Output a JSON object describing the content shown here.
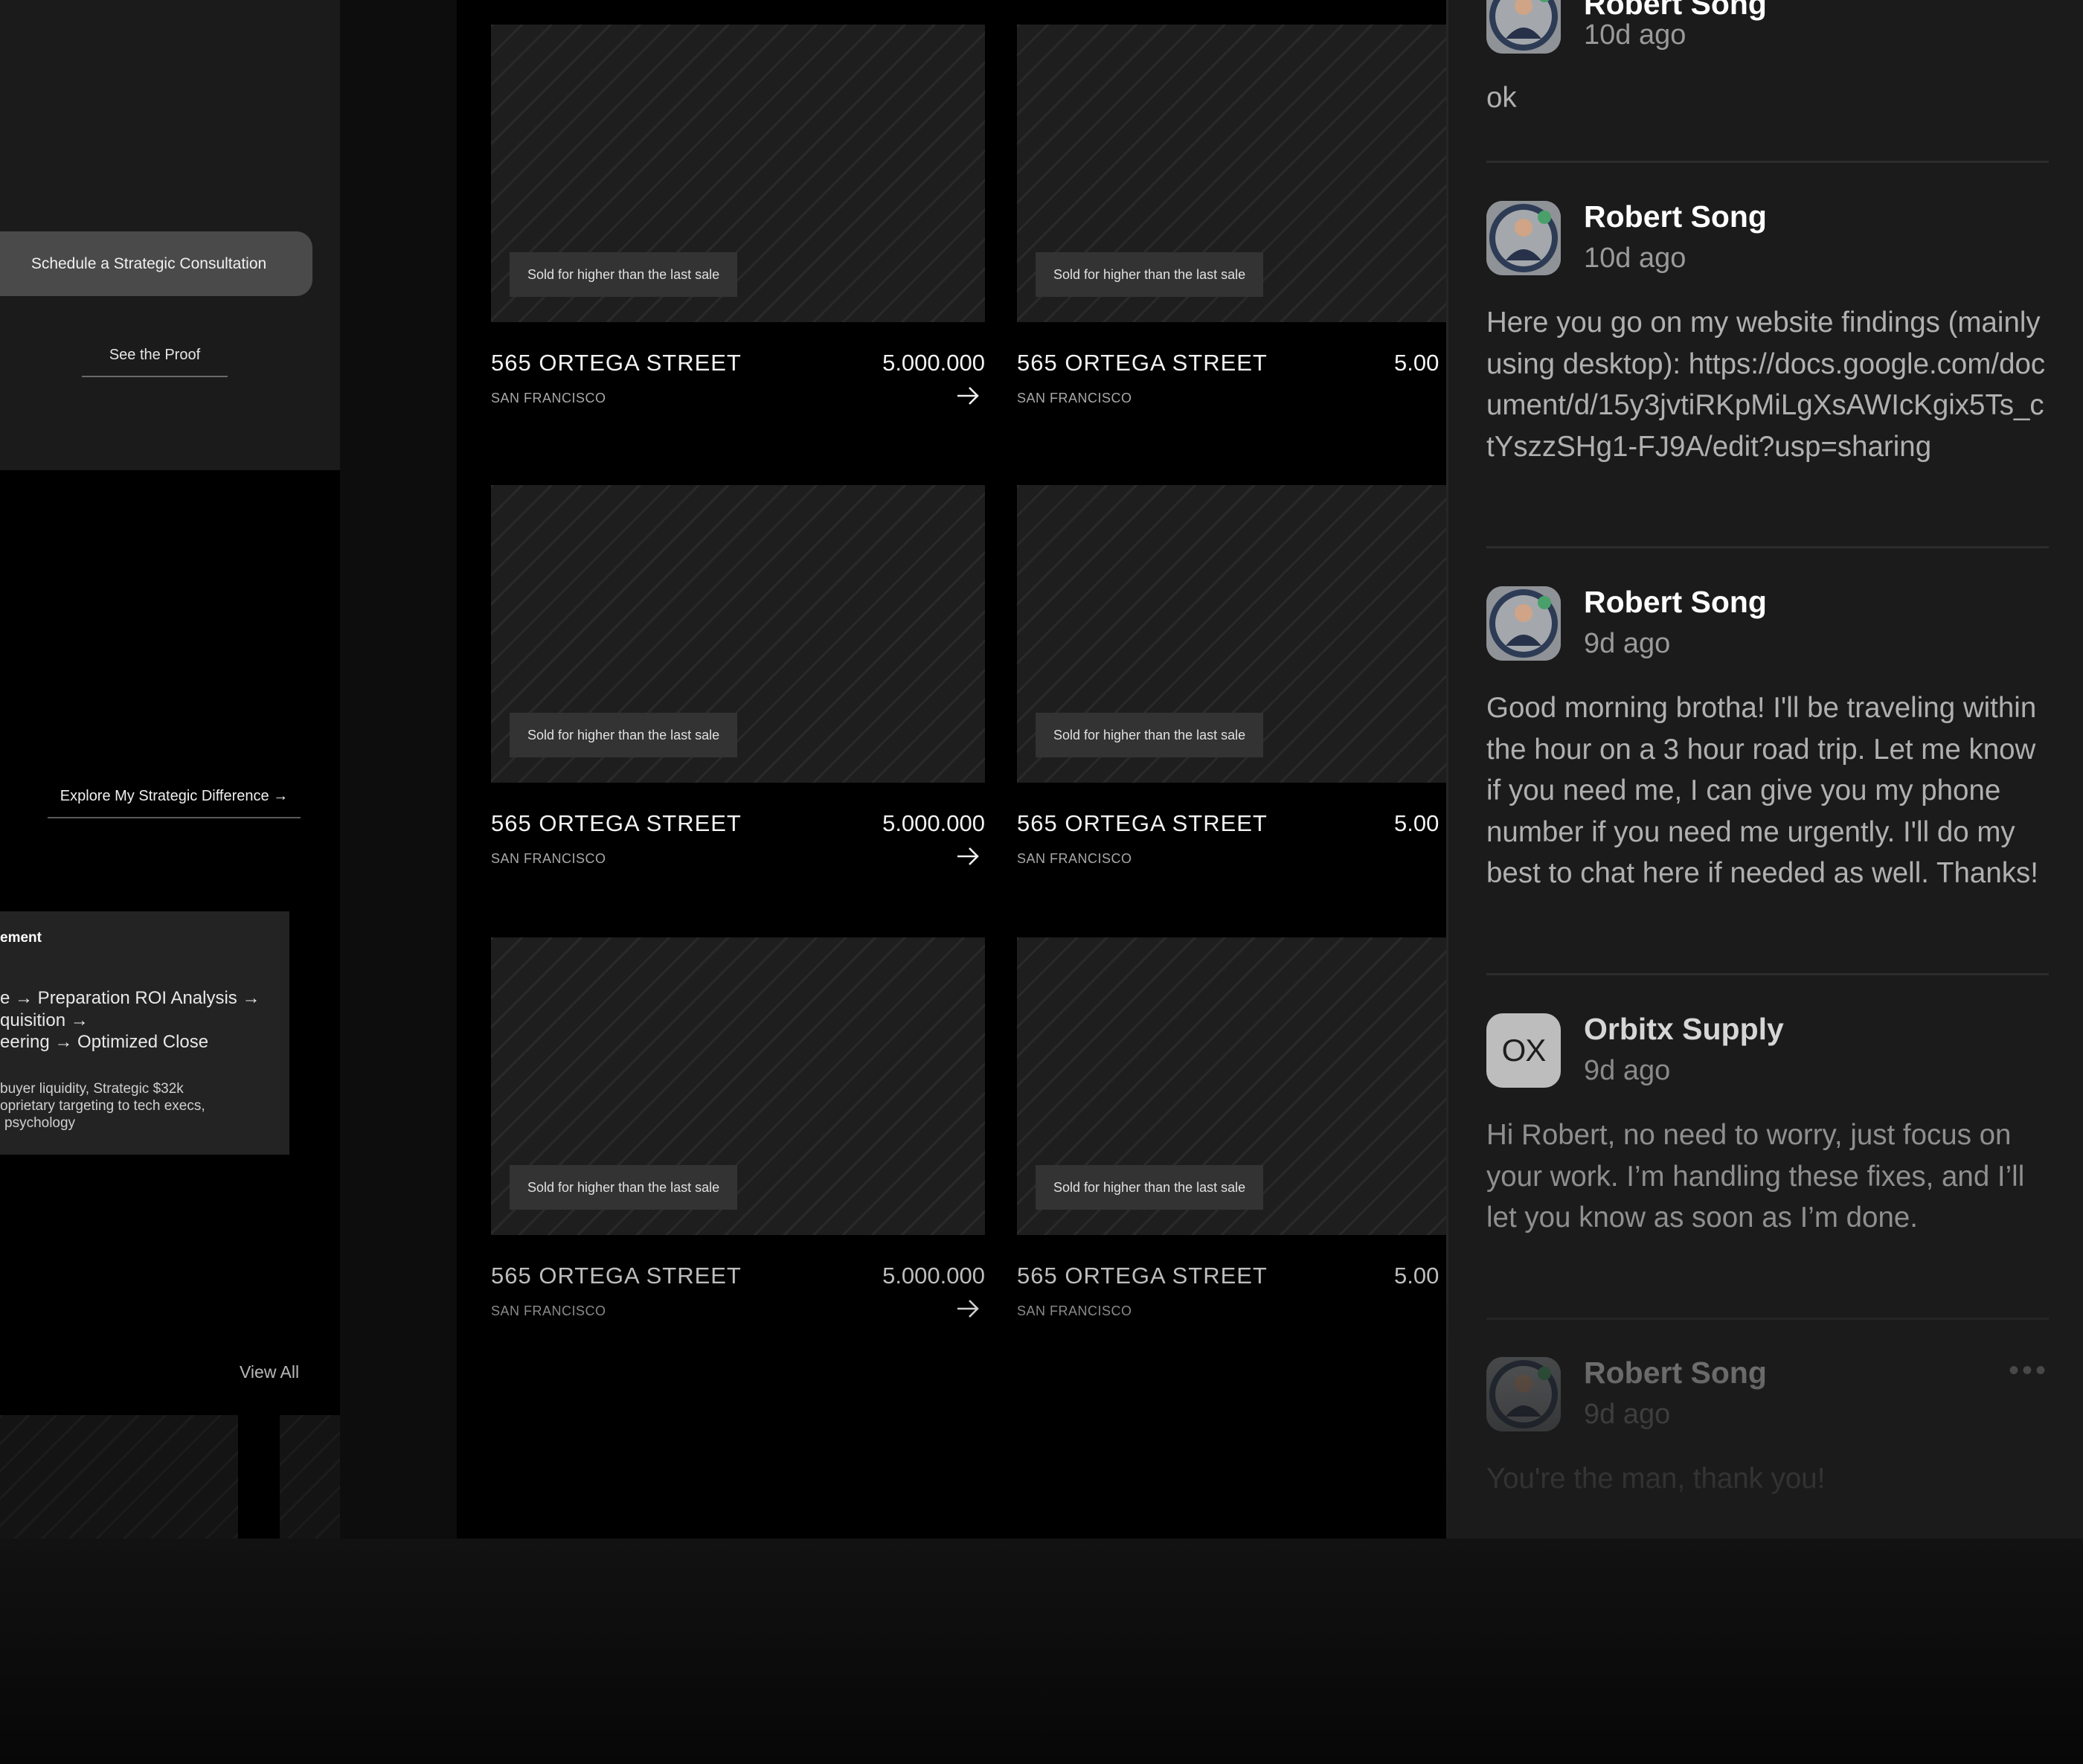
{
  "left_panel": {
    "consult_button": "Schedule a Strategic Consultation",
    "proof_link": "See the Proof",
    "explore_link": "Explore My Strategic Difference →",
    "card": {
      "title": "ement",
      "line1": "e → Preparation ROI Analysis →",
      "line2": "quisition →",
      "line3": "eering → Optimized Close",
      "small1": "buyer liquidity, Strategic $32k",
      "small2": "oprietary targeting to tech execs,",
      "small3": "psychology"
    },
    "view_all": "View All"
  },
  "listings": [
    {
      "badge": "Sold for higher than the last sale",
      "street": "565 ORTEGA STREET",
      "price": "5.000.000",
      "city": "SAN FRANCISCO"
    },
    {
      "badge": "Sold for higher than the last sale",
      "street": "565 ORTEGA STREET",
      "price": "5.00",
      "city": "SAN FRANCISCO"
    },
    {
      "badge": "Sold for higher than the last sale",
      "street": "565 ORTEGA STREET",
      "price": "5.000.000",
      "city": "SAN FRANCISCO"
    },
    {
      "badge": "Sold for higher than the last sale",
      "street": "565 ORTEGA STREET",
      "price": "5.00",
      "city": "SAN FRANCISCO"
    },
    {
      "badge": "Sold for higher than the last sale",
      "street": "565 ORTEGA STREET",
      "price": "5.000.000",
      "city": "SAN FRANCISCO"
    },
    {
      "badge": "Sold for higher than the last sale",
      "street": "565 ORTEGA STREET",
      "price": "5.00",
      "city": "SAN FRANCISCO"
    }
  ],
  "chat": {
    "messages": [
      {
        "sender": "Robert Song",
        "time": "10d ago",
        "body": "ok",
        "avatar": "robert-song-avatar"
      },
      {
        "sender": "Robert Song",
        "time": "10d ago",
        "body": "Here you go on my website findings (mainly using desktop): https://docs.google.com/document/d/15y3jvtiRKpMiLgXsAWIcKgix5Ts_ctYszzSHg1-FJ9A/edit?usp=sharing",
        "avatar": "robert-song-avatar"
      },
      {
        "sender": "Robert Song",
        "time": "9d ago",
        "body": "Good morning brotha! I'll be traveling within the hour on a 3 hour road trip. Let me know if you need me, I can give you my phone number if you need me urgently. I'll do my best to chat here if needed as well. Thanks!",
        "avatar": "robert-song-avatar"
      },
      {
        "sender": "Orbitx Supply",
        "time": "9d ago",
        "body": "Hi Robert, no need to worry, just focus on your work. I’m handling these fixes, and I’ll let you know as soon as I’m done.",
        "avatar": "OX"
      },
      {
        "sender": "Robert Song",
        "time": "9d ago",
        "body": "You're the man, thank you!",
        "avatar": "robert-song-avatar",
        "menu": "•••"
      }
    ]
  },
  "colors": {
    "background": "#0d0d0d",
    "chat_panel": "#1b1b1b",
    "listing_area": "#000000",
    "badge": "#333333",
    "button": "#4a4a4a"
  },
  "icons": [
    "arrow-right-icon",
    "more-options-icon"
  ]
}
